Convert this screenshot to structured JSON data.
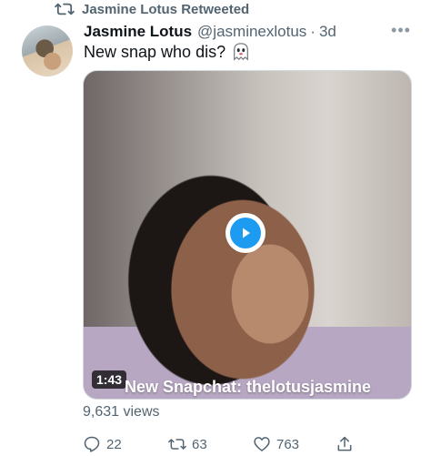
{
  "retweet": {
    "text": "Jasmine Lotus Retweeted",
    "icon": "retweet-icon"
  },
  "tweet": {
    "author_name": "Jasmine Lotus",
    "handle": "@jasminexlotus",
    "separator": "·",
    "time": "3d",
    "text": "New snap who dis?",
    "emoji_icon": "ghost-icon"
  },
  "media": {
    "duration": "1:43",
    "caption": "New Snapchat: thelotusjasmine",
    "play_icon": "play-icon"
  },
  "views": "9,631 views",
  "actions": {
    "reply_count": "22",
    "retweet_count": "63",
    "like_count": "763"
  },
  "colors": {
    "accent": "#1d9bf0",
    "text_primary": "#0f1419",
    "text_secondary": "#536471"
  }
}
